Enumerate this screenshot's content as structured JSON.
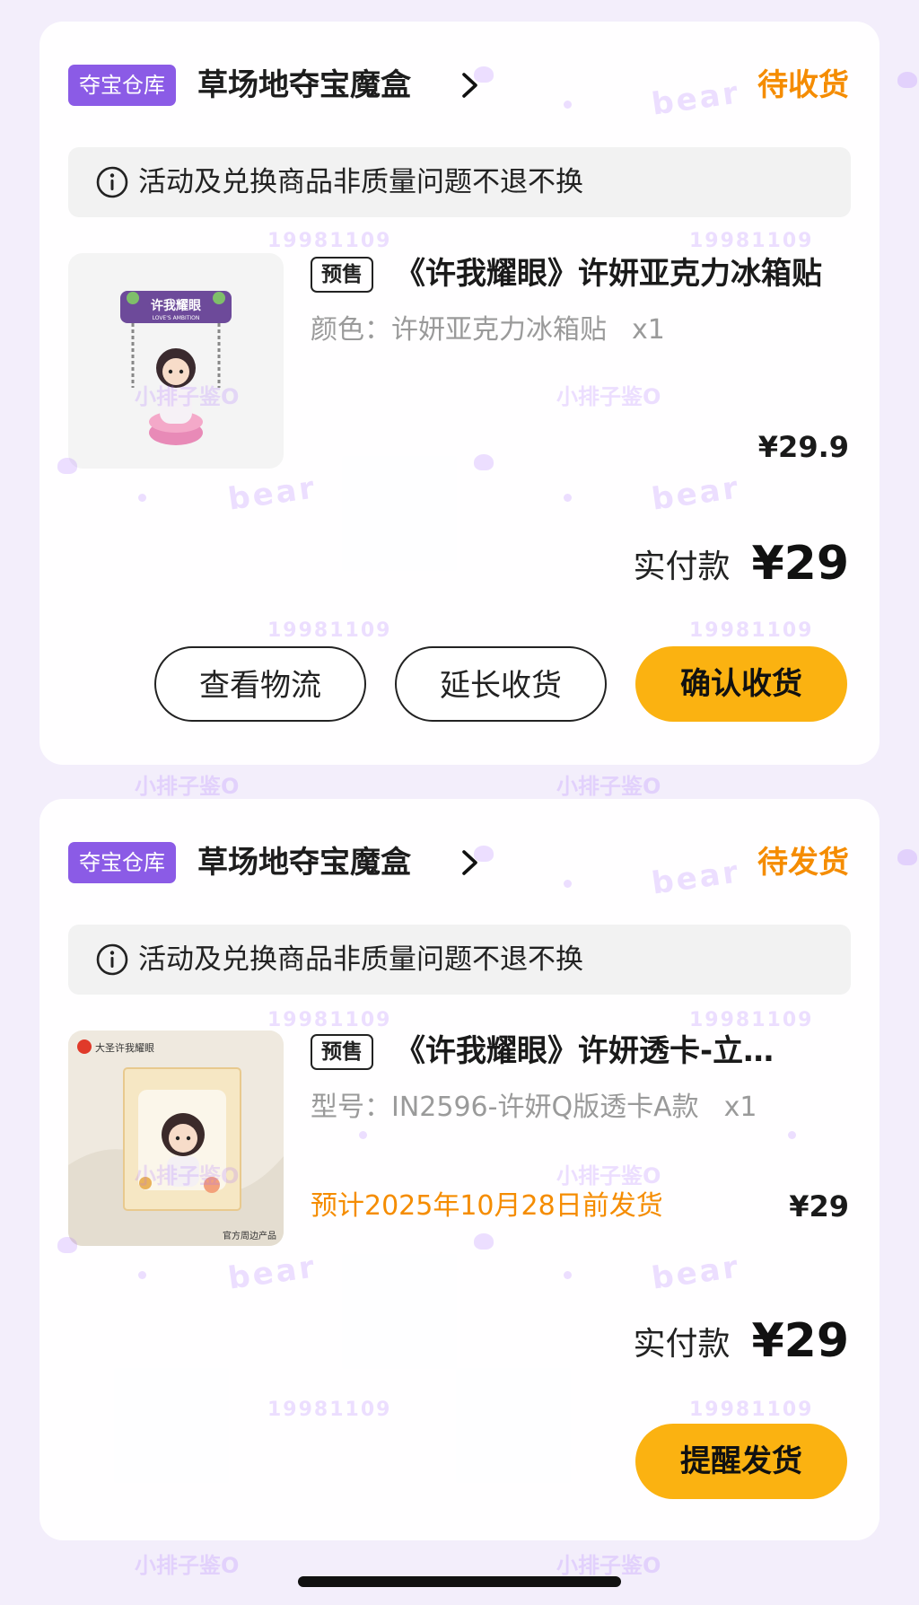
{
  "orders": [
    {
      "store_tag": "夺宝仓库",
      "store_name": "草场地夺宝魔盒",
      "status": "待收货",
      "notice": "活动及兑换商品非质量问题不退不换",
      "presale_badge": "预售",
      "title": "《许我耀眼》许妍亚克力冰箱贴",
      "spec_label": "颜色：",
      "spec_value": "许妍亚克力冰箱贴",
      "quantity": "x1",
      "unit_price": "¥29.9",
      "paid_label": "实付款",
      "paid_amount": "¥29",
      "buttons": [
        "查看物流",
        "延长收货",
        "确认收货"
      ],
      "thumb_text": {
        "banner": "许我耀眼",
        "sub": "LOVE'S AMBITION"
      }
    },
    {
      "store_tag": "夺宝仓库",
      "store_name": "草场地夺宝魔盒",
      "status": "待发货",
      "notice": "活动及兑换商品非质量问题不退不换",
      "presale_badge": "预售",
      "title": "《许我耀眼》许妍透卡-立…",
      "spec_label": "型号：",
      "spec_value": "IN2596-许妍Q版透卡A款",
      "quantity": "x1",
      "eta": "预计2025年10月28日前发货",
      "unit_price": "¥29",
      "paid_label": "实付款",
      "paid_amount": "¥29",
      "buttons": [
        "提醒发货"
      ],
      "thumb_text": {
        "brand": "大圣",
        "title": "许我耀眼",
        "footer": "官方周边产品"
      }
    }
  ],
  "watermark": {
    "number": "19981109",
    "word": "bear",
    "text": "小排子鉴O"
  },
  "colors": {
    "accent_orange": "#f58c00",
    "button_yellow": "#fbb211",
    "store_tag_purple": "#8b5be6",
    "watermark_purple": "#aa6eff"
  }
}
